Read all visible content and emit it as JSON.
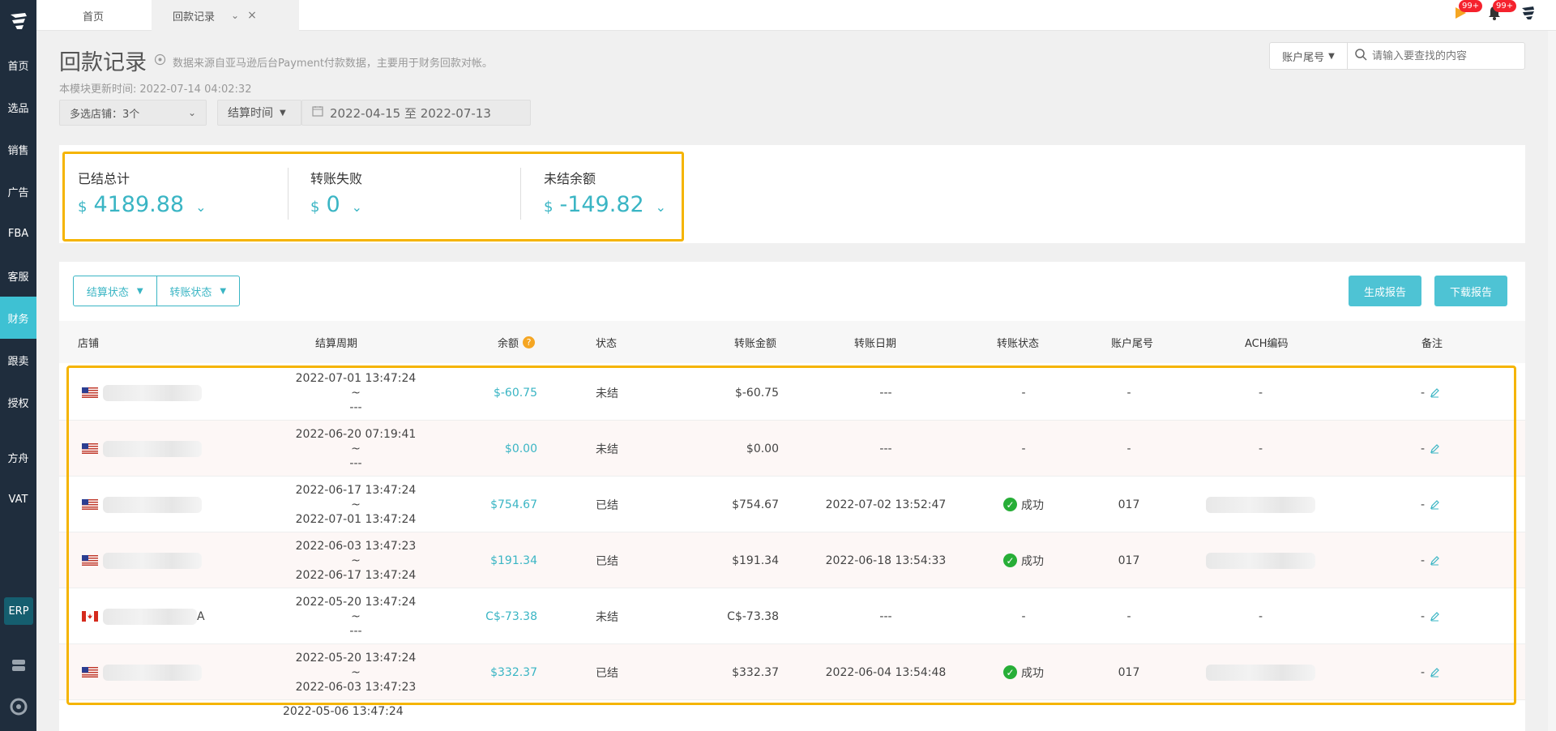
{
  "sidebar": {
    "items": [
      {
        "label": "首页",
        "active": false
      },
      {
        "label": "选品",
        "active": false
      },
      {
        "label": "销售",
        "active": false
      },
      {
        "label": "广告",
        "active": false
      },
      {
        "label": "FBA",
        "active": false
      },
      {
        "label": "客服",
        "active": false
      },
      {
        "label": "财务",
        "active": true
      },
      {
        "label": "跟卖",
        "active": false
      },
      {
        "label": "授权",
        "active": false
      },
      {
        "label": "方舟",
        "active": false
      },
      {
        "label": "VAT",
        "active": false
      }
    ],
    "erp_label": "ERP",
    "active_color": "#3ec1d3"
  },
  "tabs": {
    "home_label": "首页",
    "current_label": "回款记录",
    "close_glyph": "×"
  },
  "topbar": {
    "flag_badge": "99+",
    "bell_badge": "99+"
  },
  "header": {
    "title": "回款记录",
    "description": "数据来源自亚马逊后台Payment付款数据，主要用于财务回款对帐。",
    "update_label": "本模块更新时间:",
    "update_time": "2022-07-14 04:02:32"
  },
  "filters": {
    "store_select": "多选店铺：3个",
    "date_type": "结算时间",
    "date_range": "2022-04-15 至 2022-07-13",
    "account_select": "账户尾号",
    "search_placeholder": "请输入要查找的内容"
  },
  "summary": {
    "settled": {
      "label": "已结总计",
      "currency": "$",
      "value": "4189.88"
    },
    "failed": {
      "label": "转账失败",
      "currency": "$",
      "value": "0"
    },
    "unsettled": {
      "label": "未结余额",
      "currency": "$",
      "value": "-149.82"
    }
  },
  "table_controls": {
    "settle_status": "结算状态",
    "transfer_status": "转账状态",
    "generate_report": "生成报告",
    "download_report": "下载报告"
  },
  "table": {
    "columns": [
      "店铺",
      "结算周期",
      "余额",
      "状态",
      "转账金额",
      "转账日期",
      "转账状态",
      "账户尾号",
      "ACH编码",
      "备注"
    ],
    "rows": [
      {
        "flag": "us",
        "store_suffix": "",
        "period_start": "2022-07-01 13:47:24",
        "tilde": "~",
        "period_end": "---",
        "balance": "$-60.75",
        "status": "未结",
        "amount": "$-60.75",
        "date": "---",
        "transfer_status": "-",
        "account": "-",
        "ach": "-",
        "note": "-"
      },
      {
        "flag": "us",
        "store_suffix": "",
        "period_start": "2022-06-20 07:19:41",
        "tilde": "~",
        "period_end": "---",
        "balance": "$0.00",
        "status": "未结",
        "amount": "$0.00",
        "date": "---",
        "transfer_status": "-",
        "account": "-",
        "ach": "-",
        "note": "-"
      },
      {
        "flag": "us",
        "store_suffix": "",
        "period_start": "2022-06-17 13:47:24",
        "tilde": "~",
        "period_end": "2022-07-01 13:47:24",
        "balance": "$754.67",
        "status": "已结",
        "amount": "$754.67",
        "date": "2022-07-02 13:52:47",
        "transfer_status": "成功",
        "account": "017",
        "ach": "",
        "note": "-"
      },
      {
        "flag": "us",
        "store_suffix": "",
        "period_start": "2022-06-03 13:47:23",
        "tilde": "~",
        "period_end": "2022-06-17 13:47:24",
        "balance": "$191.34",
        "status": "已结",
        "amount": "$191.34",
        "date": "2022-06-18 13:54:33",
        "transfer_status": "成功",
        "account": "017",
        "ach": "",
        "note": "-"
      },
      {
        "flag": "ca",
        "store_suffix": "A",
        "period_start": "2022-05-20 13:47:24",
        "tilde": "~",
        "period_end": "---",
        "balance": "C$-73.38",
        "status": "未结",
        "amount": "C$-73.38",
        "date": "---",
        "transfer_status": "-",
        "account": "-",
        "ach": "-",
        "note": "-"
      },
      {
        "flag": "us",
        "store_suffix": "",
        "period_start": "2022-05-20 13:47:24",
        "tilde": "~",
        "period_end": "2022-06-03 13:47:23",
        "balance": "$332.37",
        "status": "已结",
        "amount": "$332.37",
        "date": "2022-06-04 13:54:48",
        "transfer_status": "成功",
        "account": "017",
        "ach": "",
        "note": "-"
      }
    ],
    "partial_row_start": "2022-05-06 13:47:24"
  },
  "colors": {
    "accent": "#3ab5c4",
    "highlight": "#f5b400",
    "success": "#27ae37",
    "sidebar_bg": "#1f2d3d"
  }
}
